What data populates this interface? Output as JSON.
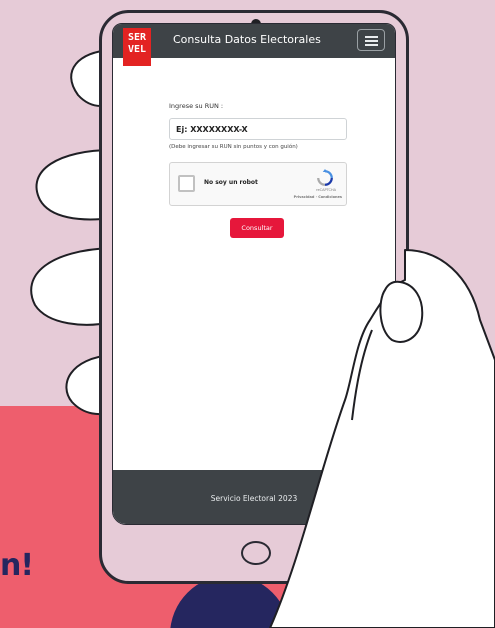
{
  "background": {
    "headline_fragment": "n!",
    "colors": {
      "pink": "#e6cbd7",
      "coral": "#ee5e6d",
      "navy": "#25265f"
    }
  },
  "app": {
    "logo_lines": [
      "SER",
      "VEL"
    ],
    "title": "Consulta Datos Electorales",
    "menu_icon": "hamburger-menu-icon",
    "header_color": "#3e4347",
    "brand_red": "#e32322"
  },
  "form": {
    "run_label": "Ingrese su RUN :",
    "run_placeholder": "Ej: XXXXXXXX-X",
    "run_value": "",
    "run_hint": "(Debe ingresar su RUN sin puntos y con guión)",
    "submit_label": "Consultar",
    "submit_color": "#e6173b"
  },
  "recaptcha": {
    "label": "No soy un robot",
    "brand": "reCAPTCHA",
    "links": "Privacidad · Condiciones",
    "icon": "recaptcha-logo-icon"
  },
  "footer": {
    "text": "Servicio Electoral 2023"
  }
}
